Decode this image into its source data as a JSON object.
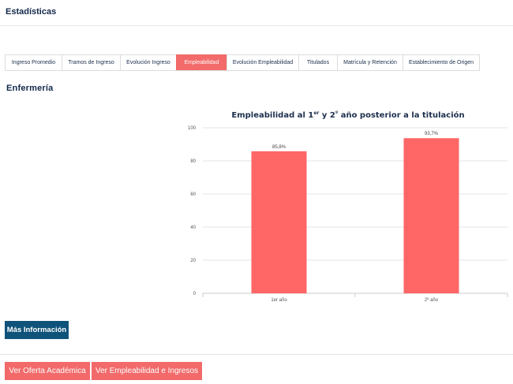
{
  "header": {
    "title": "Estadísticas"
  },
  "tabs": [
    {
      "label": "Ingreso Promedio",
      "active": false
    },
    {
      "label": "Tramos de Ingreso",
      "active": false
    },
    {
      "label": "Evolución Ingreso",
      "active": false
    },
    {
      "label": "Empleabilidad",
      "active": true
    },
    {
      "label": "Evolución Empleabilidad",
      "active": false
    },
    {
      "label": "Titulados",
      "active": false
    },
    {
      "label": "Matrícula y Retención",
      "active": false
    },
    {
      "label": "Establecimiento de Origen",
      "active": false
    }
  ],
  "section": {
    "title": "Enfermería"
  },
  "chart_data": {
    "type": "bar",
    "title": "Empleabilidad al 1er y 2º año posterior a la titulación",
    "categories": [
      "1er año",
      "2º año"
    ],
    "values": [
      85.8,
      93.7
    ],
    "value_labels": [
      "85,8%",
      "93,7%"
    ],
    "ylim": [
      0,
      100
    ],
    "yticks": [
      0,
      20,
      40,
      60,
      80,
      100
    ],
    "grid": true,
    "bar_color": "#ff6666"
  },
  "buttons": {
    "more_info": "Más Información",
    "ver_oferta": "Ver Oferta Académica",
    "ver_empleabilidad": "Ver Empleabilidad e Ingresos"
  },
  "colors": {
    "accent": "#f26a6a",
    "primary": "#10537a",
    "title": "#13294b"
  }
}
